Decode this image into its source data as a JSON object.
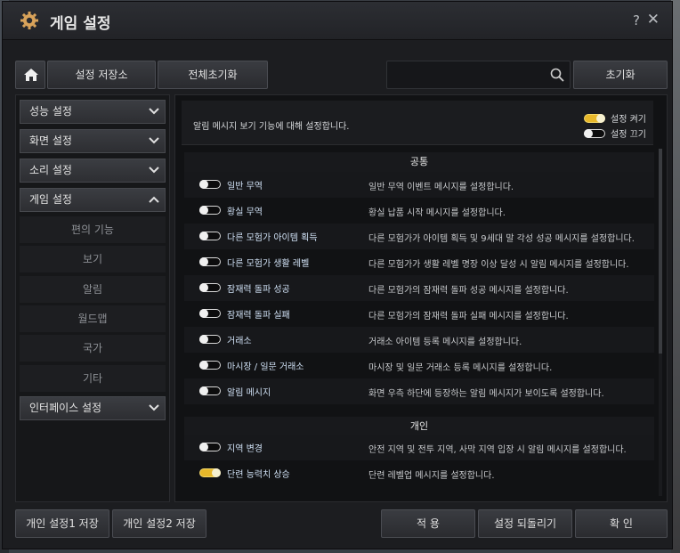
{
  "window": {
    "title": "게임 설정",
    "help": "?",
    "close": "✕"
  },
  "toolbar": {
    "save_store": "설정 저장소",
    "reset_all": "전체초기화",
    "search_placeholder": "",
    "reset": "초기화"
  },
  "sidebar": {
    "performance": "성능 설정",
    "display": "화면 설정",
    "sound": "소리 설정",
    "game": "게임 설정",
    "sub": [
      "편의 기능",
      "보기",
      "알림",
      "월드맵",
      "국가",
      "기타"
    ],
    "interface": "인터페이스 설정"
  },
  "content": {
    "info": "알림 메시지 보기 기능에 대해 설정합니다.",
    "legend_on": "설정 켜기",
    "legend_off": "설정 끄기",
    "section_common": "공통",
    "section_personal": "개인",
    "common_rows": [
      {
        "name": "일반 무역",
        "desc": "일반 무역 이벤트 메시지를 설정합니다.",
        "on": false
      },
      {
        "name": "황실 무역",
        "desc": "황실 납품 시작 메시지를 설정합니다.",
        "on": false
      },
      {
        "name": "다른 모험가 아이템 획득",
        "desc": "다른 모험가가 아이템 획득 및 9세대 말 각성 성공 메시지를 설정합니다.",
        "on": false
      },
      {
        "name": "다른 모험가 생활 레벨",
        "desc": "다른 모험가가 생활 레벨 명장 이상 달성 시 알림 메시지를 설정합니다.",
        "on": false
      },
      {
        "name": "잠재력 돌파 성공",
        "desc": "다른 모험가의 잠재력 돌파 성공 메시지를 설정합니다.",
        "on": false
      },
      {
        "name": "잠재력 돌파 실패",
        "desc": "다른 모험가의 잠재력 돌파 실패 메시지를 설정합니다.",
        "on": false
      },
      {
        "name": "거래소",
        "desc": "거래소 아이템 등록 메시지를 설정합니다.",
        "on": false
      },
      {
        "name": "마시장 / 일문 거래소",
        "desc": "마시장 및 일문 거래소 등록 메시지를 설정합니다.",
        "on": false
      },
      {
        "name": "알림 메시지",
        "desc": "화면 우측 하단에 등장하는 알림 메시지가 보이도록 설정합니다.",
        "on": false
      }
    ],
    "personal_rows": [
      {
        "name": "지역 변경",
        "desc": "안전 지역 및 전투 지역, 사막 지역 입장 시 알림 메시지를 설정합니다.",
        "on": false
      },
      {
        "name": "단련 능력치 상승",
        "desc": "단련 레벨업 메시지를 설정합니다.",
        "on": true
      }
    ]
  },
  "bottom": {
    "save1": "개인 설정1 저장",
    "save2": "개인 설정2 저장",
    "apply": "적 용",
    "revert": "설정 되돌리기",
    "confirm": "확 인"
  },
  "colors": {
    "toggle_on": "#e8b82a",
    "accent_text": "#cfe0f4"
  }
}
